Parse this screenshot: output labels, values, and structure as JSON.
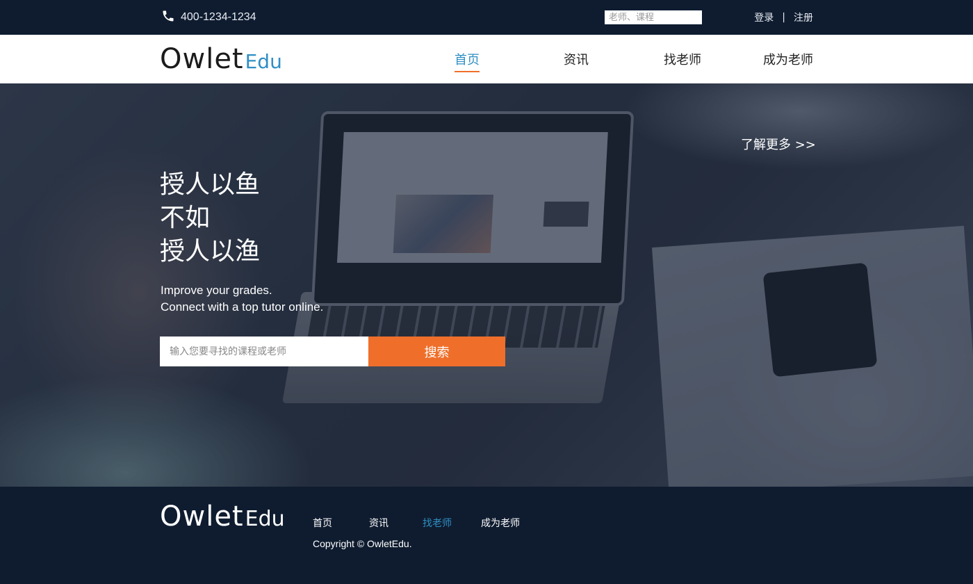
{
  "topbar": {
    "phone_number": "400-1234-1234",
    "search_placeholder": "老师、课程",
    "login": "登录",
    "separator": "|",
    "register": "注册"
  },
  "header": {
    "logo_main": "Owlet",
    "logo_sub": "Edu",
    "nav": [
      {
        "label": "首页",
        "active": true
      },
      {
        "label": "资讯",
        "active": false
      },
      {
        "label": "找老师",
        "active": false
      },
      {
        "label": "成为老师",
        "active": false
      }
    ]
  },
  "hero": {
    "learn_more": "了解更多 >>",
    "headline": [
      "授人以鱼",
      "不如",
      "授人以渔"
    ],
    "subline": [
      "Improve your grades.",
      "Connect with a top tutor online."
    ],
    "search_placeholder": "输入您要寻找的课程或老师",
    "search_button": "搜索"
  },
  "footer": {
    "logo_main": "Owlet",
    "logo_sub": "Edu",
    "nav": [
      {
        "label": "首页",
        "active": false
      },
      {
        "label": "资讯",
        "active": false
      },
      {
        "label": "找老师",
        "active": true
      },
      {
        "label": "成为老师",
        "active": false
      }
    ],
    "copyright": "Copyright © OwletEdu."
  },
  "colors": {
    "dark_bg": "#0f1c30",
    "accent_blue": "#2f8fc3",
    "accent_orange": "#ef6f2a"
  },
  "icons": {
    "phone": "phone-icon"
  }
}
